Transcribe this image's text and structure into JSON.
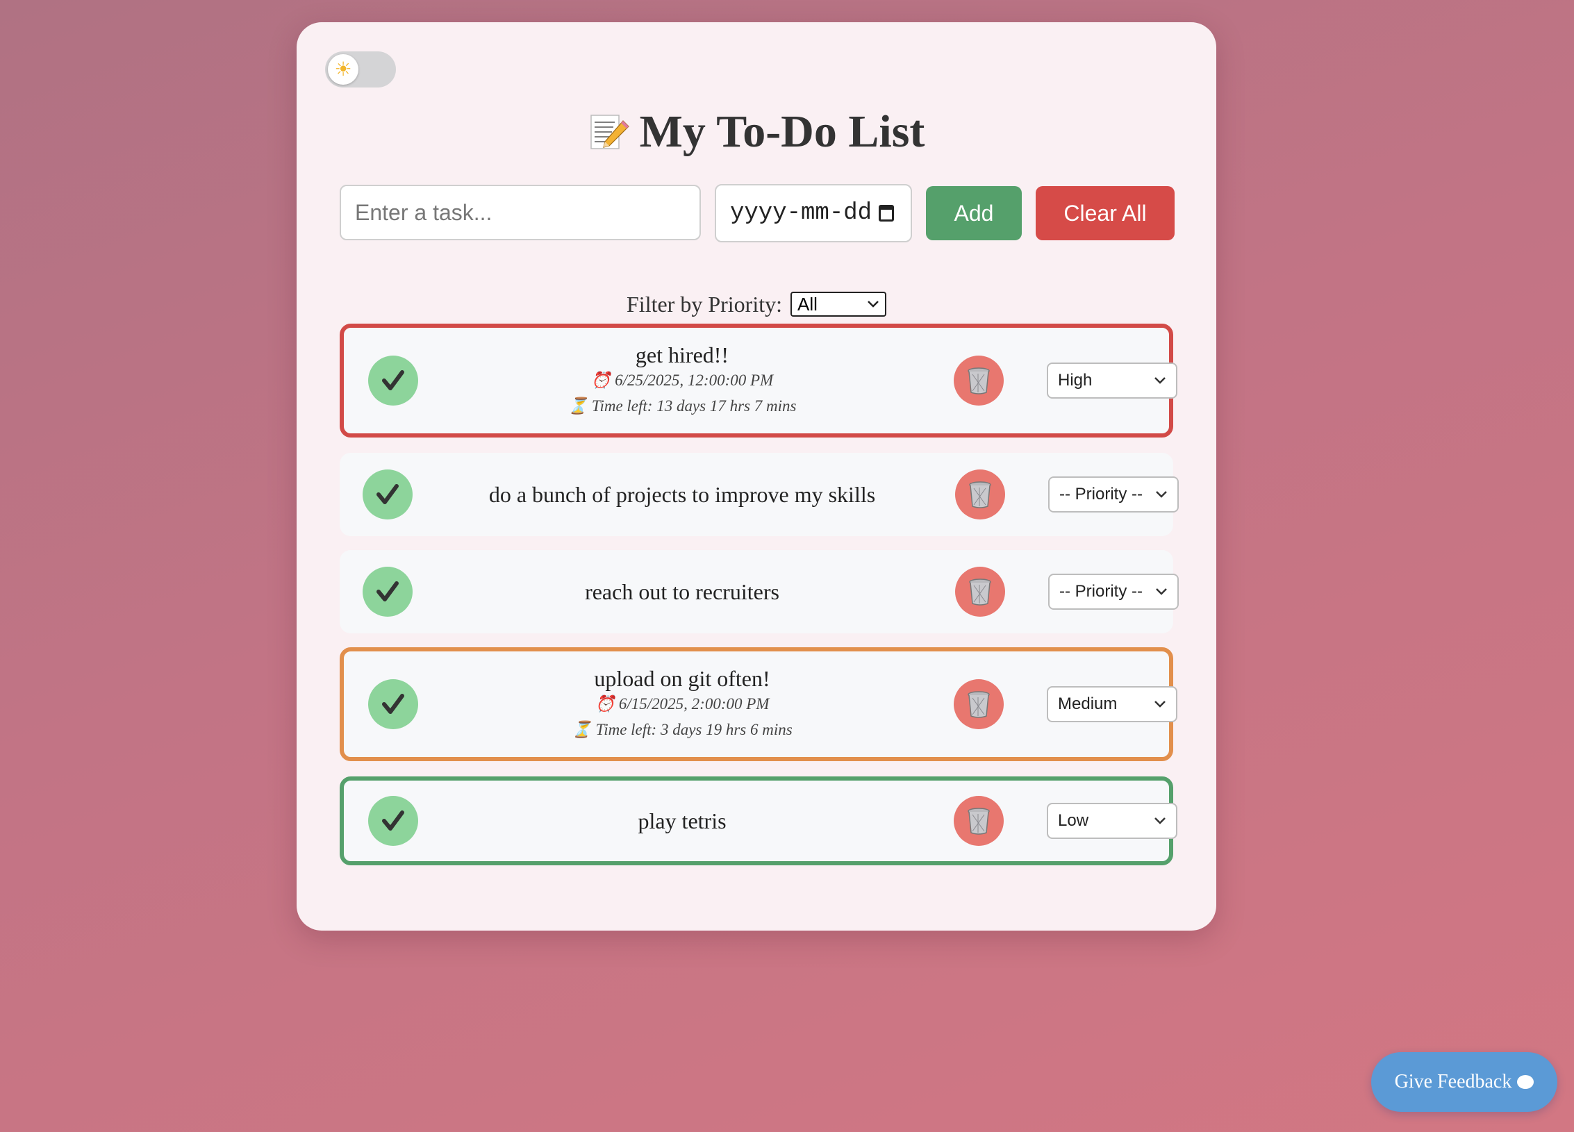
{
  "app": {
    "title": "My To-Do List",
    "title_icon": "memo-pencil-icon",
    "theme_toggle_icon": "sun-icon"
  },
  "inputs": {
    "task_placeholder": "Enter a task...",
    "date_placeholder": "yyyy-mm-dd"
  },
  "buttons": {
    "add": "Add",
    "clear_all": "Clear All",
    "feedback": "Give Feedback"
  },
  "filter": {
    "label": "Filter by Priority:",
    "selected": "All"
  },
  "tasks": [
    {
      "text": "get hired!!",
      "due": "⏰ 6/25/2025, 12:00:00 PM",
      "time_left": "⏳ Time left: 13 days 17 hrs 7 mins",
      "priority": "High"
    },
    {
      "text": "do a bunch of projects to improve my skills",
      "priority": "-- Priority --"
    },
    {
      "text": "reach out to recruiters",
      "priority": "-- Priority --"
    },
    {
      "text": "upload on git often!",
      "due": "⏰ 6/15/2025, 2:00:00 PM",
      "time_left": "⏳ Time left: 3 days 19 hrs 6 mins",
      "priority": "Medium"
    },
    {
      "text": "play tetris",
      "priority": "Low"
    }
  ],
  "colors": {
    "high": "#d24a47",
    "medium": "#e28f4c",
    "low": "#55a06b",
    "check": "#8dd49b",
    "trash": "#e8776f",
    "feedback": "#5b9ad6"
  }
}
